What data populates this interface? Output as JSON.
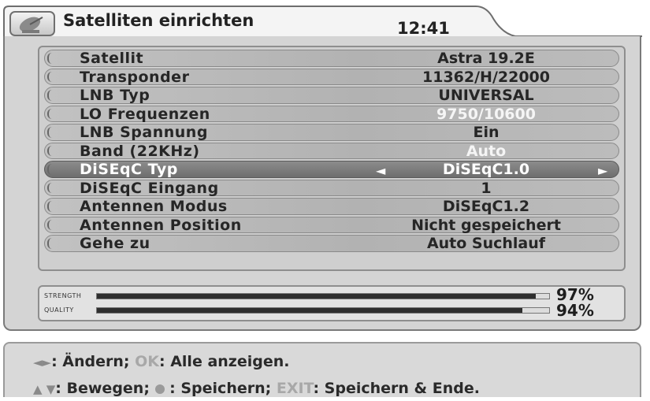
{
  "header": {
    "title": "Satelliten einrichten",
    "time": "12:41",
    "logo_icon": "satellite-dish-icon"
  },
  "settings": [
    {
      "label": "Satellit",
      "value": "Astra 19.2E"
    },
    {
      "label": "Transponder",
      "value": "11362/H/22000"
    },
    {
      "label": "LNB Typ",
      "value": "UNIVERSAL"
    },
    {
      "label": "LO Frequenzen",
      "value": "9750/10600"
    },
    {
      "label": "LNB Spannung",
      "value": "Ein"
    },
    {
      "label": "Band (22KHz)",
      "value": "Auto"
    },
    {
      "label": "DiSEqC Typ",
      "value": "DiSEqC1.0"
    },
    {
      "label": "DiSEqC Eingang",
      "value": "1"
    },
    {
      "label": "Antennen Modus",
      "value": "DiSEqC1.2"
    },
    {
      "label": "Antennen Position",
      "value": "Nicht gespeichert"
    },
    {
      "label": "Gehe zu",
      "value": "Auto Suchlauf"
    }
  ],
  "signal": {
    "strength_label": "STRENGTH",
    "strength_value": 97,
    "strength_text": "97%",
    "quality_label": "QUALITY",
    "quality_value": 94,
    "quality_text": "94%"
  },
  "help": {
    "line1_symbols": "◄►",
    "line1_text_a": ": Ändern; ",
    "line1_key": "OK",
    "line1_text_b": ": Alle anzeigen.",
    "line2_symbols": "▲ ▼",
    "line2_text_a": ": Bewegen; ",
    "line2_text_b": " : Speichern; ",
    "line2_key": "EXIT",
    "line2_text_c": ": Speichern & Ende."
  },
  "colors": {
    "selected_row": "#7c7c7c",
    "panel_bg": "#d4d4d4",
    "signal_fill": "#2e2e2e"
  }
}
